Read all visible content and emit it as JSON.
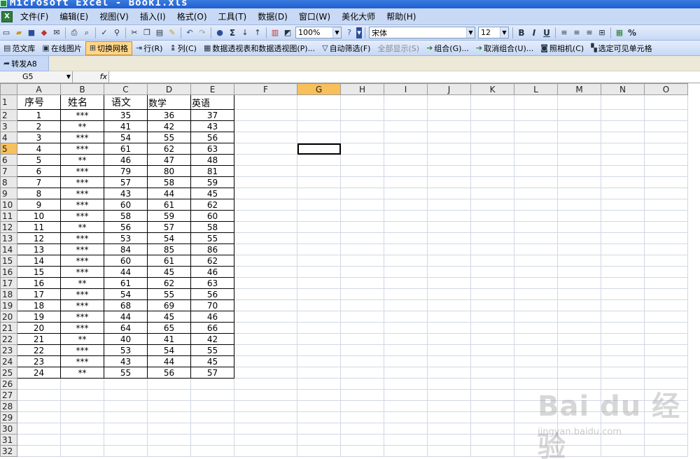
{
  "title": "Microsoft Excel - Book1.xls",
  "menu": [
    "文件(F)",
    "编辑(E)",
    "视图(V)",
    "插入(I)",
    "格式(O)",
    "工具(T)",
    "数据(D)",
    "窗口(W)",
    "美化大师",
    "帮助(H)"
  ],
  "standard_toolbar": {
    "zoom": "100%",
    "font": "宋体",
    "font_size": "12",
    "bold": "B",
    "italic": "I",
    "underline": "U",
    "percent": "%",
    "sigma": "Σ"
  },
  "toolbar2": {
    "items": [
      {
        "label": "范文库",
        "icon": "book-icon"
      },
      {
        "label": "在线图片",
        "icon": "picture-icon"
      },
      {
        "label": "切换网格",
        "icon": "grid-icon",
        "active": true
      },
      {
        "label": "行(R)",
        "icon": "row-icon"
      },
      {
        "label": "列(C)",
        "icon": "column-icon"
      },
      {
        "label": "数据透视表和数据透视图(P)...",
        "icon": "pivot-icon"
      },
      {
        "label": "自动筛选(F)",
        "icon": "filter-icon"
      },
      {
        "label": "全部显示(S)",
        "icon": "",
        "disabled": true
      },
      {
        "label": "组合(G)...",
        "icon": "group-icon"
      },
      {
        "label": "取消组合(U)...",
        "icon": "ungroup-icon"
      },
      {
        "label": "照相机(C)",
        "icon": "camera-icon"
      },
      {
        "label": "选定可见单元格",
        "icon": "visible-cells-icon"
      }
    ]
  },
  "toolbar3": {
    "label": "转发A8"
  },
  "formula_bar": {
    "name_box": "G5",
    "fx": "fx",
    "formula": ""
  },
  "columns": [
    "A",
    "B",
    "C",
    "D",
    "E",
    "F",
    "G",
    "H",
    "I",
    "J",
    "K",
    "L",
    "M",
    "N",
    "O"
  ],
  "selected_column": "G",
  "selected_row": 5,
  "active_cell": "G5",
  "row_count": 32,
  "headers": [
    "序号",
    "姓名",
    "语文",
    "数学",
    "英语"
  ],
  "rows": [
    [
      "1",
      "***",
      "35",
      "36",
      "37"
    ],
    [
      "2",
      "**",
      "41",
      "42",
      "43"
    ],
    [
      "3",
      "***",
      "54",
      "55",
      "56"
    ],
    [
      "4",
      "***",
      "61",
      "62",
      "63"
    ],
    [
      "5",
      "**",
      "46",
      "47",
      "48"
    ],
    [
      "6",
      "***",
      "79",
      "80",
      "81"
    ],
    [
      "7",
      "***",
      "57",
      "58",
      "59"
    ],
    [
      "8",
      "***",
      "43",
      "44",
      "45"
    ],
    [
      "9",
      "***",
      "60",
      "61",
      "62"
    ],
    [
      "10",
      "***",
      "58",
      "59",
      "60"
    ],
    [
      "11",
      "**",
      "56",
      "57",
      "58"
    ],
    [
      "12",
      "***",
      "53",
      "54",
      "55"
    ],
    [
      "13",
      "***",
      "84",
      "85",
      "86"
    ],
    [
      "14",
      "***",
      "60",
      "61",
      "62"
    ],
    [
      "15",
      "***",
      "44",
      "45",
      "46"
    ],
    [
      "16",
      "**",
      "61",
      "62",
      "63"
    ],
    [
      "17",
      "***",
      "54",
      "55",
      "56"
    ],
    [
      "18",
      "***",
      "68",
      "69",
      "70"
    ],
    [
      "19",
      "***",
      "44",
      "45",
      "46"
    ],
    [
      "20",
      "***",
      "64",
      "65",
      "66"
    ],
    [
      "21",
      "**",
      "40",
      "41",
      "42"
    ],
    [
      "22",
      "***",
      "53",
      "54",
      "55"
    ],
    [
      "23",
      "***",
      "43",
      "44",
      "45"
    ],
    [
      "24",
      "**",
      "55",
      "56",
      "57"
    ]
  ],
  "watermark": {
    "logo": "Bai du 经验",
    "sub": "jingyan.baidu.com"
  }
}
